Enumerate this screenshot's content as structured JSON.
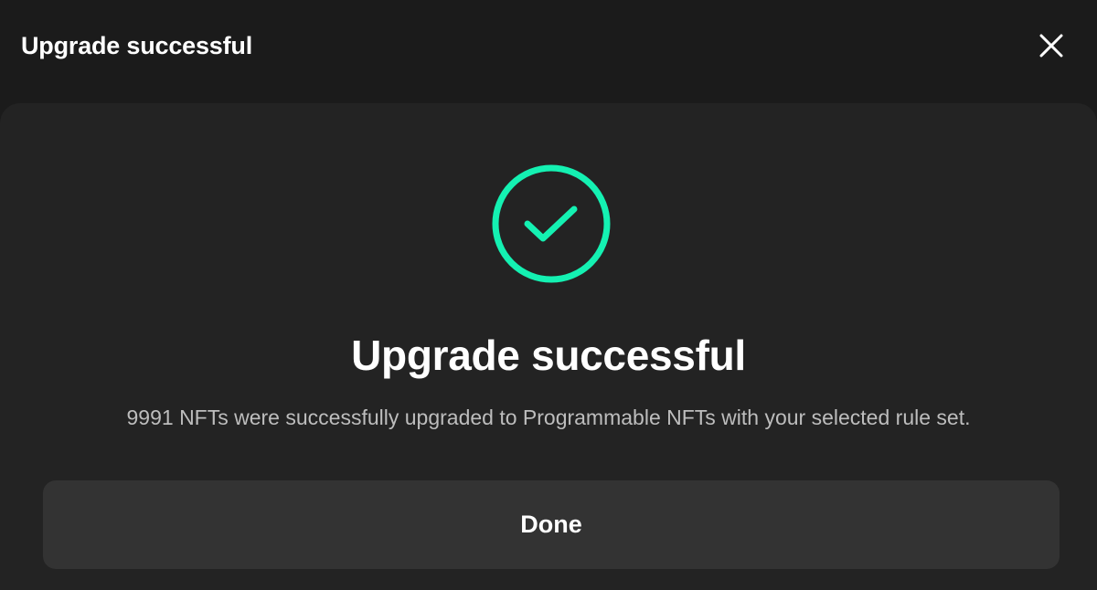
{
  "header": {
    "title": "Upgrade successful",
    "close_icon": "close-icon"
  },
  "body": {
    "status_icon": "check-circle-icon",
    "heading": "Upgrade successful",
    "message": "9991 NFTs were successfully upgraded to Programmable NFTs with your selected rule set.",
    "done_label": "Done"
  },
  "colors": {
    "background": "#1b1b1b",
    "panel": "#232323",
    "accent": "#14f1b2",
    "button": "#333333",
    "text_primary": "#ffffff",
    "text_secondary": "#bdbdbd"
  }
}
